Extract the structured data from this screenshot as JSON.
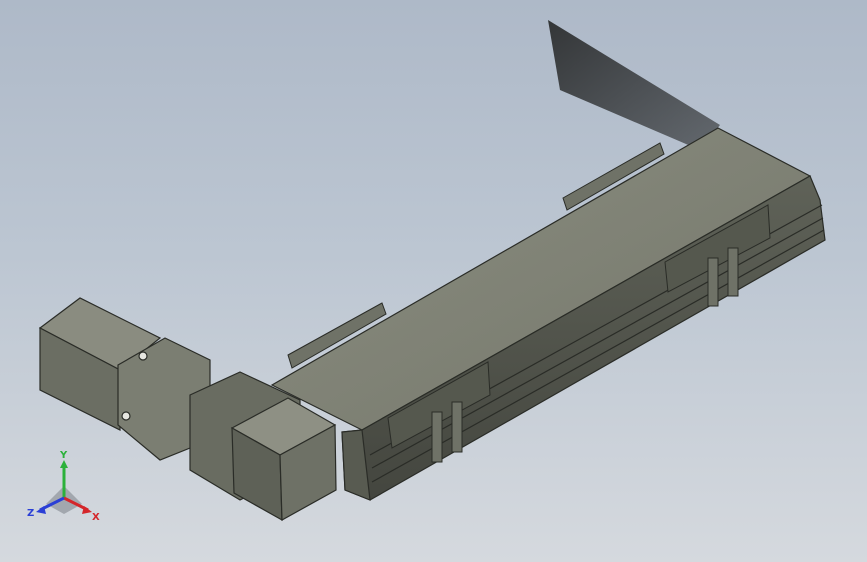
{
  "viewport": {
    "background_top": "#aeb9c8",
    "background_bottom": "#d5d9de"
  },
  "model": {
    "body_color": "#6f7267",
    "edge_color": "#2a2c27",
    "shadow_color": "#2d2f30",
    "components": [
      "linear-module-body",
      "top-cover-plate",
      "carriage-front",
      "carriage-rear",
      "mounting-brackets",
      "coupling-housing",
      "gear-reducer",
      "servo-motor",
      "motor-shadow"
    ]
  },
  "triad": {
    "x_label": "X",
    "y_label": "Y",
    "z_label": "Z",
    "x_color": "#d4262a",
    "y_color": "#2bb13a",
    "z_color": "#2a3fd6"
  }
}
